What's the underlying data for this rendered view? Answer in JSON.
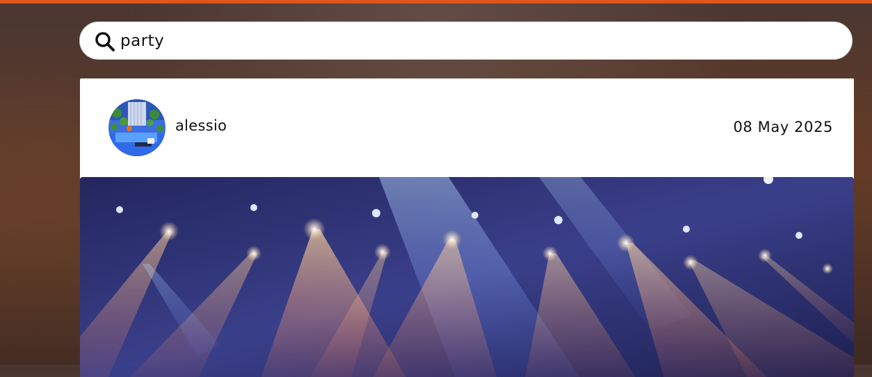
{
  "search": {
    "value": "party",
    "icon": "search-icon"
  },
  "post": {
    "username": "alessio",
    "date": "08 May 2025",
    "avatar_icon": "user-avatar",
    "image_description_icon": "party-lights-photo"
  },
  "colors": {
    "accent_bar": "#e0541e",
    "card": "#ffffff",
    "text": "#111111"
  }
}
